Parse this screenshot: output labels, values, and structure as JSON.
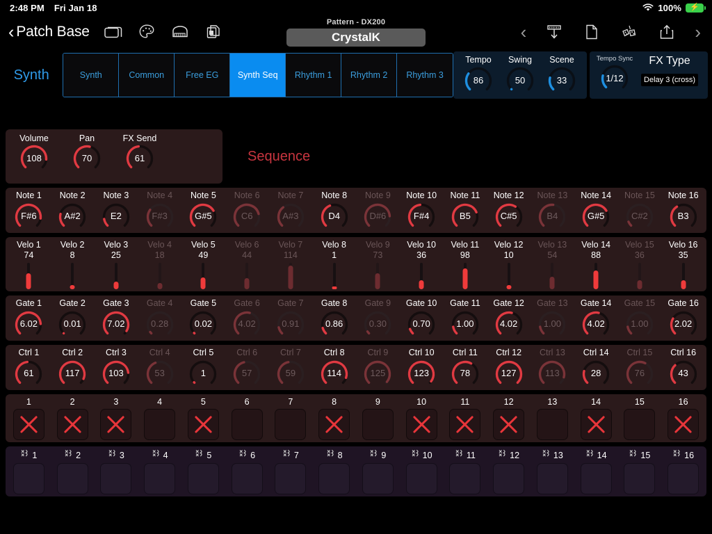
{
  "statusbar": {
    "time": "2:48 PM",
    "date": "Fri Jan 18",
    "battery_pct": "100%",
    "wifi_icon": "wifi-icon",
    "battery_icon": "battery-charging-icon"
  },
  "navbar": {
    "back_label": "Patch Base",
    "back_icon": "chevron-left-icon",
    "icons": [
      "window-icon",
      "palette-icon",
      "piano-icon",
      "copy-document-icon"
    ],
    "pattern_label": "Pattern - DX200",
    "pattern_name": "CrystalK",
    "right_icons": [
      "chevron-left-icon",
      "download-to-device-icon",
      "new-document-icon",
      "randomize-dice-icon",
      "share-export-icon",
      "chevron-right-icon"
    ]
  },
  "tabbar": {
    "section_title": "Synth",
    "tabs": [
      {
        "label": "Synth",
        "active": false
      },
      {
        "label": "Common",
        "active": false
      },
      {
        "label": "Free EG",
        "active": false
      },
      {
        "label": "Synth Seq",
        "active": true
      },
      {
        "label": "Rhythm 1",
        "active": false
      },
      {
        "label": "Rhythm 2",
        "active": false
      },
      {
        "label": "Rhythm 3",
        "active": false
      }
    ]
  },
  "global_panel": {
    "tempo": {
      "label": "Tempo",
      "value": "86",
      "pct": 0.3
    },
    "swing": {
      "label": "Swing",
      "value": "50",
      "pct": 0.0
    },
    "scene": {
      "label": "Scene",
      "value": "33",
      "pct": 0.22
    }
  },
  "fx_panel": {
    "tempo_sync": {
      "label": "Tempo Sync",
      "value": "1/12",
      "pct": 0.22
    },
    "fx_type": {
      "label": "FX Type",
      "value": "Delay 3 (cross)"
    }
  },
  "mixer": {
    "volume": {
      "label": "Volume",
      "value": "108",
      "pct": 0.85
    },
    "pan": {
      "label": "Pan",
      "value": "70",
      "pct": 0.55
    },
    "fx_send": {
      "label": "FX Send",
      "value": "61",
      "pct": 0.48
    }
  },
  "sequence_title": "Sequence",
  "colors": {
    "accent_red": "#e8353a",
    "accent_blue": "#0a8cf0",
    "panel_red": "#2b1a1b",
    "panel_purple": "#1f1424"
  },
  "rows": {
    "note": {
      "prefix": "Note",
      "cells": [
        {
          "label": "Note 1",
          "value": "F#6",
          "active": true,
          "pct": 0.86
        },
        {
          "label": "Note 2",
          "value": "A#2",
          "active": true,
          "pct": 0.22
        },
        {
          "label": "Note 3",
          "value": "E2",
          "active": true,
          "pct": 0.13
        },
        {
          "label": "Note 4",
          "value": "F#3",
          "active": false,
          "pct": 0.3
        },
        {
          "label": "Note 5",
          "value": "G#5",
          "active": true,
          "pct": 0.72
        },
        {
          "label": "Note 6",
          "value": "C6",
          "active": false,
          "pct": 0.78
        },
        {
          "label": "Note 7",
          "value": "A#3",
          "active": false,
          "pct": 0.36
        },
        {
          "label": "Note 8",
          "value": "D4",
          "active": true,
          "pct": 0.42
        },
        {
          "label": "Note 9",
          "value": "D#6",
          "active": false,
          "pct": 0.82
        },
        {
          "label": "Note 10",
          "value": "F#4",
          "active": true,
          "pct": 0.48
        },
        {
          "label": "Note 11",
          "value": "B5",
          "active": true,
          "pct": 0.75
        },
        {
          "label": "Note 12",
          "value": "C#5",
          "active": true,
          "pct": 0.62
        },
        {
          "label": "Note 13",
          "value": "B4",
          "active": false,
          "pct": 0.52
        },
        {
          "label": "Note 14",
          "value": "G#5",
          "active": true,
          "pct": 0.72
        },
        {
          "label": "Note 15",
          "value": "C#2",
          "active": false,
          "pct": 0.08
        },
        {
          "label": "Note 16",
          "value": "B3",
          "active": true,
          "pct": 0.38
        }
      ]
    },
    "velo": {
      "prefix": "Velo",
      "cells": [
        {
          "label": "Velo 1",
          "value": "74",
          "active": true,
          "pct": 0.58
        },
        {
          "label": "Velo 2",
          "value": "8",
          "active": true,
          "pct": 0.06
        },
        {
          "label": "Velo 3",
          "value": "25",
          "active": true,
          "pct": 0.2
        },
        {
          "label": "Velo 4",
          "value": "18",
          "active": false,
          "pct": 0.14
        },
        {
          "label": "Velo 5",
          "value": "49",
          "active": true,
          "pct": 0.39
        },
        {
          "label": "Velo 6",
          "value": "44",
          "active": false,
          "pct": 0.35
        },
        {
          "label": "Velo 7",
          "value": "114",
          "active": false,
          "pct": 0.9
        },
        {
          "label": "Velo 8",
          "value": "1",
          "active": true,
          "pct": 0.01
        },
        {
          "label": "Velo 9",
          "value": "73",
          "active": false,
          "pct": 0.57
        },
        {
          "label": "Velo 10",
          "value": "36",
          "active": true,
          "pct": 0.28
        },
        {
          "label": "Velo 11",
          "value": "98",
          "active": true,
          "pct": 0.77
        },
        {
          "label": "Velo 12",
          "value": "10",
          "active": true,
          "pct": 0.08
        },
        {
          "label": "Velo 13",
          "value": "54",
          "active": false,
          "pct": 0.43
        },
        {
          "label": "Velo 14",
          "value": "88",
          "active": true,
          "pct": 0.69
        },
        {
          "label": "Velo 15",
          "value": "36",
          "active": false,
          "pct": 0.28
        },
        {
          "label": "Velo 16",
          "value": "35",
          "active": true,
          "pct": 0.28
        }
      ]
    },
    "gate": {
      "prefix": "Gate",
      "cells": [
        {
          "label": "Gate 1",
          "value": "6.02",
          "active": true,
          "pct": 0.82
        },
        {
          "label": "Gate 2",
          "value": "0.01",
          "active": true,
          "pct": 0.0
        },
        {
          "label": "Gate 3",
          "value": "7.02",
          "active": true,
          "pct": 0.95
        },
        {
          "label": "Gate 4",
          "value": "0.28",
          "active": false,
          "pct": 0.03
        },
        {
          "label": "Gate 5",
          "value": "0.02",
          "active": true,
          "pct": 0.01
        },
        {
          "label": "Gate 6",
          "value": "4.02",
          "active": false,
          "pct": 0.55
        },
        {
          "label": "Gate 7",
          "value": "0.91",
          "active": false,
          "pct": 0.12
        },
        {
          "label": "Gate 8",
          "value": "0.86",
          "active": true,
          "pct": 0.11
        },
        {
          "label": "Gate 9",
          "value": "0.30",
          "active": false,
          "pct": 0.04
        },
        {
          "label": "Gate 10",
          "value": "0.70",
          "active": true,
          "pct": 0.09
        },
        {
          "label": "Gate 11",
          "value": "1.00",
          "active": true,
          "pct": 0.13
        },
        {
          "label": "Gate 12",
          "value": "4.02",
          "active": true,
          "pct": 0.55
        },
        {
          "label": "Gate 13",
          "value": "1.00",
          "active": false,
          "pct": 0.13
        },
        {
          "label": "Gate 14",
          "value": "4.02",
          "active": true,
          "pct": 0.55
        },
        {
          "label": "Gate 15",
          "value": "1.00",
          "active": false,
          "pct": 0.13
        },
        {
          "label": "Gate 16",
          "value": "2.02",
          "active": true,
          "pct": 0.28
        }
      ]
    },
    "ctrl": {
      "prefix": "Ctrl",
      "cells": [
        {
          "label": "Ctrl 1",
          "value": "61",
          "active": true,
          "pct": 0.48
        },
        {
          "label": "Ctrl 2",
          "value": "117",
          "active": true,
          "pct": 0.92
        },
        {
          "label": "Ctrl 3",
          "value": "103",
          "active": true,
          "pct": 0.81
        },
        {
          "label": "Ctrl 4",
          "value": "53",
          "active": false,
          "pct": 0.42
        },
        {
          "label": "Ctrl 5",
          "value": "1",
          "active": true,
          "pct": 0.01
        },
        {
          "label": "Ctrl 6",
          "value": "57",
          "active": false,
          "pct": 0.45
        },
        {
          "label": "Ctrl 7",
          "value": "59",
          "active": false,
          "pct": 0.46
        },
        {
          "label": "Ctrl 8",
          "value": "114",
          "active": true,
          "pct": 0.9
        },
        {
          "label": "Ctrl 9",
          "value": "125",
          "active": false,
          "pct": 0.98
        },
        {
          "label": "Ctrl 10",
          "value": "123",
          "active": true,
          "pct": 0.97
        },
        {
          "label": "Ctrl 11",
          "value": "78",
          "active": true,
          "pct": 0.61
        },
        {
          "label": "Ctrl 12",
          "value": "127",
          "active": true,
          "pct": 1.0
        },
        {
          "label": "Ctrl 13",
          "value": "113",
          "active": false,
          "pct": 0.89
        },
        {
          "label": "Ctrl 14",
          "value": "28",
          "active": true,
          "pct": 0.22
        },
        {
          "label": "Ctrl 15",
          "value": "76",
          "active": false,
          "pct": 0.6
        },
        {
          "label": "Ctrl 16",
          "value": "43",
          "active": true,
          "pct": 0.34
        }
      ]
    },
    "step": {
      "cells": [
        {
          "label": "1",
          "on": true
        },
        {
          "label": "2",
          "on": true
        },
        {
          "label": "3",
          "on": true
        },
        {
          "label": "4",
          "on": false
        },
        {
          "label": "5",
          "on": true
        },
        {
          "label": "6",
          "on": false
        },
        {
          "label": "7",
          "on": false
        },
        {
          "label": "8",
          "on": true
        },
        {
          "label": "9",
          "on": false
        },
        {
          "label": "10",
          "on": true
        },
        {
          "label": "11",
          "on": true
        },
        {
          "label": "12",
          "on": true
        },
        {
          "label": "13",
          "on": false
        },
        {
          "label": "14",
          "on": true
        },
        {
          "label": "15",
          "on": false
        },
        {
          "label": "16",
          "on": true
        }
      ]
    },
    "tie": {
      "icon": "tie-link-icon",
      "cells": [
        {
          "label": "1",
          "on": false
        },
        {
          "label": "2",
          "on": false
        },
        {
          "label": "3",
          "on": false
        },
        {
          "label": "4",
          "on": false
        },
        {
          "label": "5",
          "on": false
        },
        {
          "label": "6",
          "on": false
        },
        {
          "label": "7",
          "on": false
        },
        {
          "label": "8",
          "on": false
        },
        {
          "label": "9",
          "on": false
        },
        {
          "label": "10",
          "on": false
        },
        {
          "label": "11",
          "on": false
        },
        {
          "label": "12",
          "on": false
        },
        {
          "label": "13",
          "on": false
        },
        {
          "label": "14",
          "on": false
        },
        {
          "label": "15",
          "on": false
        },
        {
          "label": "16",
          "on": false
        }
      ]
    }
  }
}
